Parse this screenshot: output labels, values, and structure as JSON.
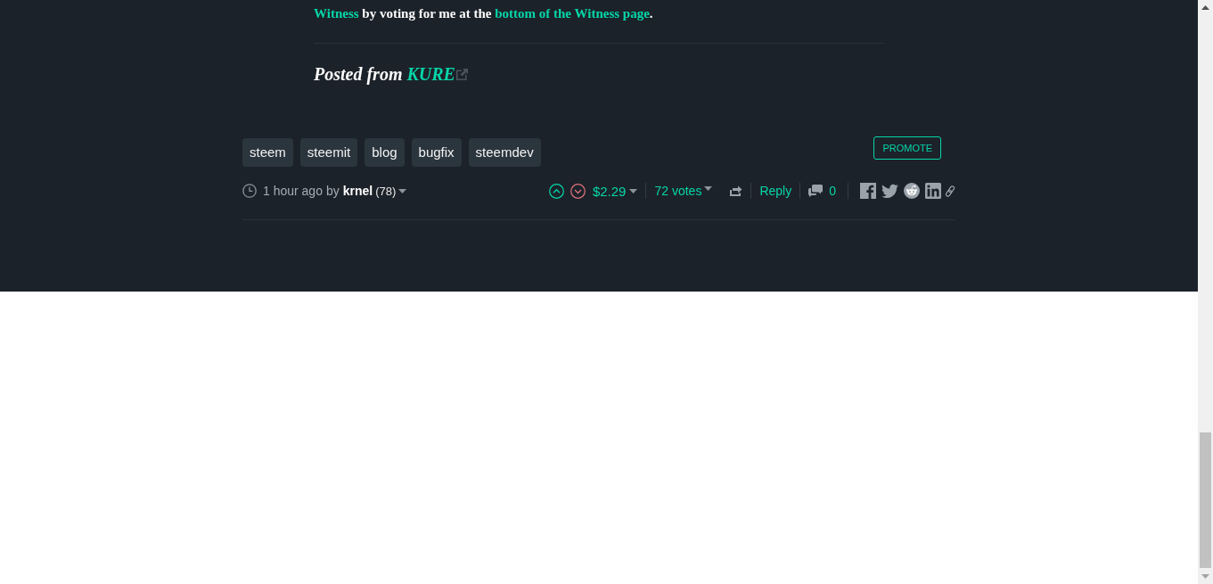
{
  "post": {
    "closing_paragraph": [
      {
        "kind": "link",
        "text": "Witness"
      },
      {
        "kind": "text",
        "text": " by voting for me at the "
      },
      {
        "kind": "link",
        "text": "bottom of the Witness page"
      },
      {
        "kind": "text",
        "text": "."
      }
    ],
    "posted_from": {
      "label": "Posted from",
      "source": "KURE",
      "external_link": true
    }
  },
  "tags": [
    "steem",
    "steemit",
    "blog",
    "bugfix",
    "steemdev"
  ],
  "promote_button": {
    "label": "PROMOTE"
  },
  "footer": {
    "time": "1 hour ago",
    "by": "by",
    "author": "krnel",
    "reputation": "(78)",
    "payout": "$2.29",
    "votes": "72 votes",
    "reply": "Reply",
    "comments": "0"
  }
}
